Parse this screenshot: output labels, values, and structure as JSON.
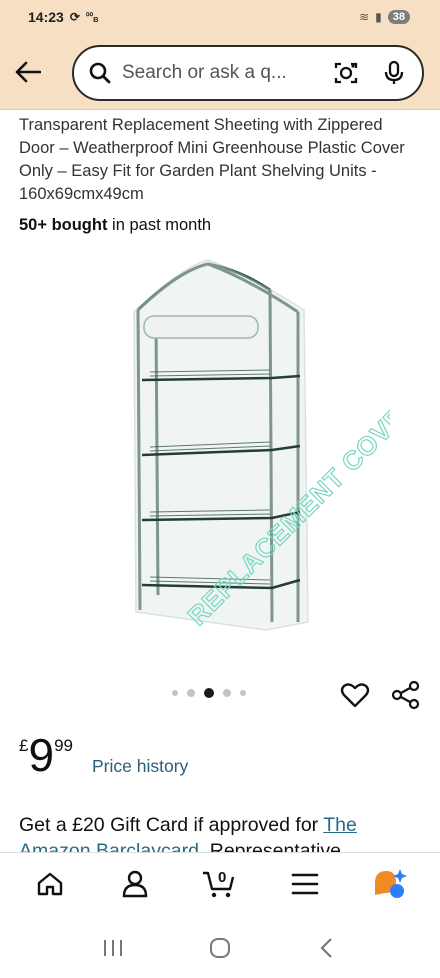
{
  "status": {
    "time": "14:23",
    "battery": "38"
  },
  "search": {
    "placeholder": "Search or ask a q..."
  },
  "product": {
    "title": "Transparent Replacement Sheeting with Zippered Door – Weatherproof Mini Greenhouse Plastic Cover Only – Easy Fit for Garden Plant Shelving Units - 160x69cmx49cm",
    "bought_strong": "50+ bought",
    "bought_rest": " in past month",
    "image_watermark": "REPLACEMENT COVER ONLY",
    "carousel": {
      "count": 5,
      "active_index": 2
    },
    "price": {
      "symbol": "£",
      "whole": "9",
      "fraction": "99"
    },
    "price_history_label": "Price history",
    "giftcard": {
      "text": "Get a £20 Gift Card if approved for ",
      "link": "The Amazon Barclaycard",
      "rest": ". Representative"
    }
  },
  "bottom_nav": {
    "items": [
      "home-icon",
      "account-icon",
      "cart-icon",
      "menu-icon",
      "rufus-icon"
    ],
    "cart_count": "0"
  },
  "colors": {
    "header_bg": "#f6dfc2",
    "link": "#2a6a8a",
    "rufus_orange": "#f08a24",
    "rufus_blue": "#2d7ff9"
  }
}
